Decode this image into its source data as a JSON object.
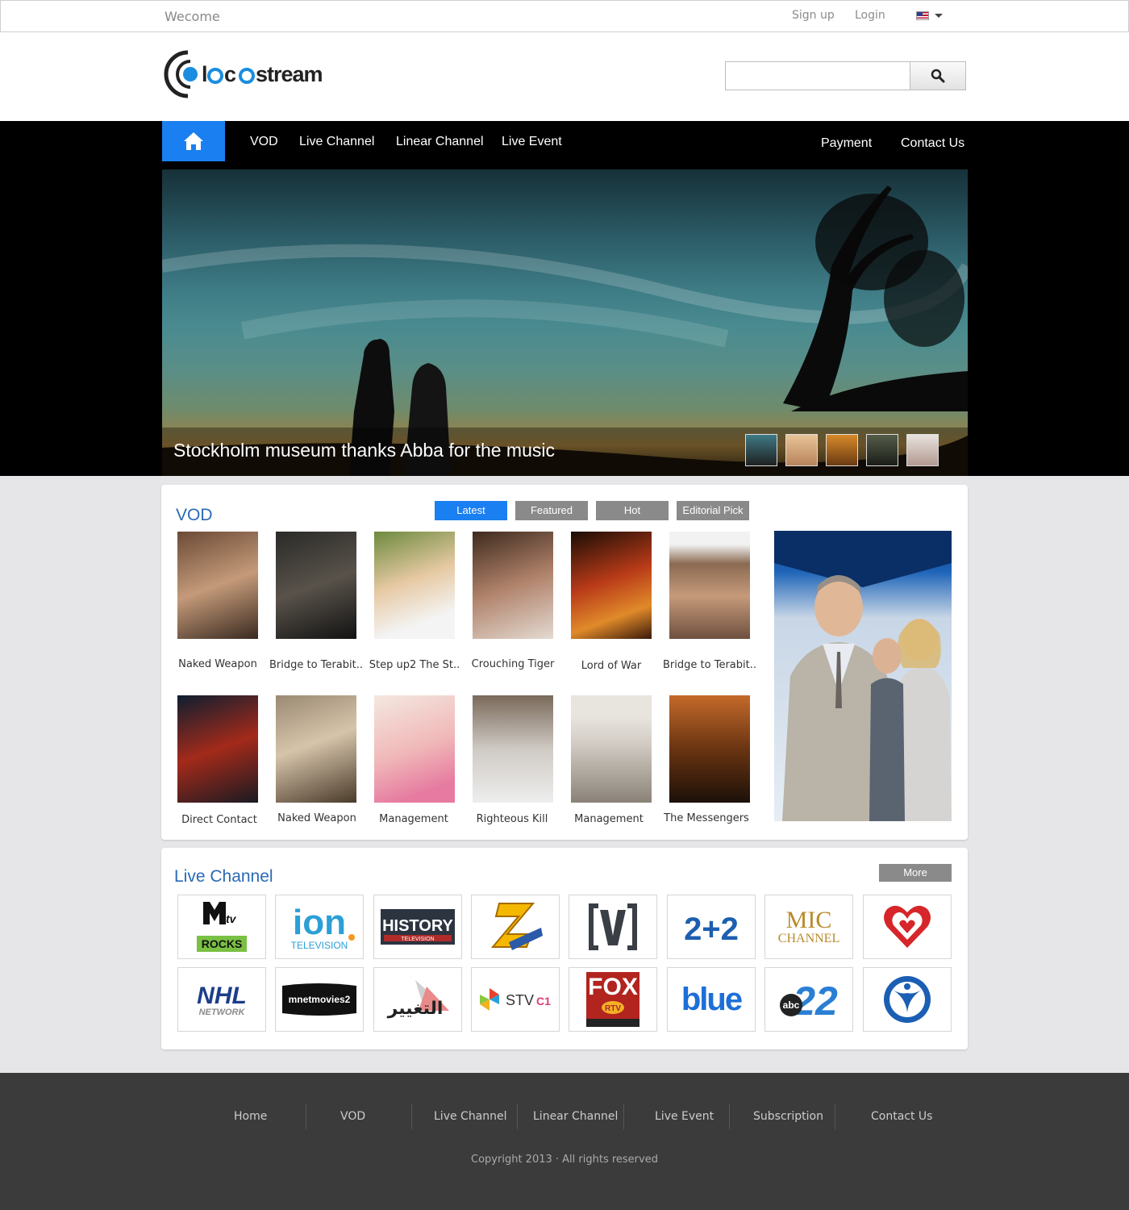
{
  "topbar": {
    "welcome": "Wecome",
    "signup": "Sign up",
    "login": "Login"
  },
  "brand": {
    "logo_text": "locostream",
    "accent": "#1a7ff0"
  },
  "search": {
    "placeholder": "",
    "value": ""
  },
  "nav": {
    "items": [
      "VOD",
      "Live Channel",
      "Linear Channel",
      "Live Event"
    ],
    "right": [
      "Payment",
      "Contact Us"
    ]
  },
  "hero": {
    "caption": "Stockholm museum thanks Abba for the music"
  },
  "vod": {
    "title": "VOD",
    "tabs": [
      "Latest",
      "Featured",
      "Hot",
      "Editorial Pick"
    ],
    "active_tab": "Latest",
    "row1": [
      "Naked Weapon",
      "Bridge to Terabit..",
      "Step up2 The St..",
      "Crouching Tiger",
      "Lord of War",
      "Bridge to Terabit.."
    ],
    "row2": [
      "Direct Contact",
      "Naked Weapon",
      "Management",
      "Righteous Kill",
      "Management",
      "The Messengers"
    ]
  },
  "live": {
    "title": "Live Channel",
    "more": "More",
    "channels": [
      "MTV Rocks",
      "ion Television",
      "History Television",
      "Zee Classic",
      "Channel V",
      "2+2",
      "MIC Channel",
      "Heart channel",
      "NHL Network",
      "mnetmovies2",
      "Al Taghyeer",
      "STV C1",
      "Fox RTV",
      "blue",
      "abc 22",
      "Sport channel"
    ]
  },
  "footer": {
    "links": [
      "Home",
      "VOD",
      "Live Channel",
      "Linear Channel",
      "Live Event",
      "Subscription",
      "Contact Us"
    ],
    "copyright": "Copyright 2013 · All rights reserved"
  }
}
